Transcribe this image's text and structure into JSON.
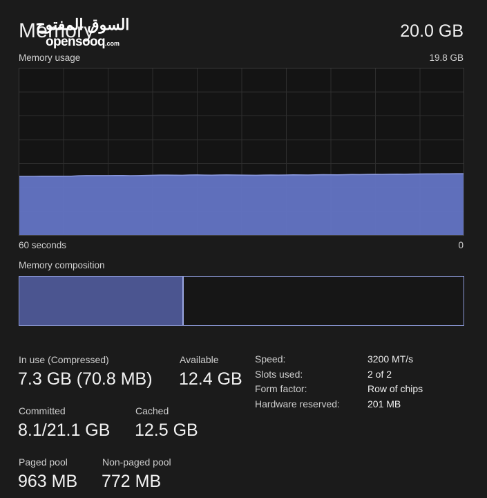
{
  "header": {
    "title": "Memory",
    "total": "20.0 GB",
    "watermark_arabic": "السوق المفتوح",
    "watermark_latin": "opensooq",
    "watermark_tld": ".com"
  },
  "usage_graph": {
    "caption": "Memory usage",
    "max_label": "19.8 GB",
    "axis_left": "60 seconds",
    "axis_right": "0"
  },
  "composition": {
    "caption": "Memory composition",
    "in_use_percent": 37,
    "free_percent": 63
  },
  "stats": {
    "in_use": {
      "label": "In use (Compressed)",
      "value": "7.3 GB (70.8 MB)"
    },
    "available": {
      "label": "Available",
      "value": "12.4 GB"
    },
    "committed": {
      "label": "Committed",
      "value": "8.1/21.1 GB"
    },
    "cached": {
      "label": "Cached",
      "value": "12.5 GB"
    },
    "paged_pool": {
      "label": "Paged pool",
      "value": "963 MB"
    },
    "non_paged_pool": {
      "label": "Non-paged pool",
      "value": "772 MB"
    }
  },
  "specs": [
    {
      "key": "Speed:",
      "value": "3200 MT/s"
    },
    {
      "key": "Slots used:",
      "value": "2 of 2"
    },
    {
      "key": "Form factor:",
      "value": "Row of chips"
    },
    {
      "key": "Hardware reserved:",
      "value": "201 MB"
    }
  ],
  "colors": {
    "background": "#1b1b1b",
    "graph_background": "#141414",
    "graph_fill": "#6374c4",
    "graph_line": "#8a98dd",
    "composition_fill": "#4b5590",
    "composition_border": "#8d9ad8",
    "grid": "#333333"
  },
  "chart_data": {
    "type": "area",
    "title": "Memory usage",
    "xlabel": "",
    "ylabel": "",
    "ylim": [
      0,
      19.8
    ],
    "xlim": [
      60,
      0
    ],
    "x_tick_labels": [
      "60 seconds",
      "0"
    ],
    "y_max_label": "19.8 GB",
    "grid": true,
    "legend": "none",
    "series": [
      {
        "name": "Memory in use (GB)",
        "values": [
          7.05,
          7.05,
          7.05,
          7.06,
          7.06,
          7.06,
          7.07,
          7.07,
          7.12,
          7.14,
          7.14,
          7.14,
          7.14,
          7.15,
          7.15,
          7.13,
          7.14,
          7.16,
          7.18,
          7.2,
          7.2,
          7.19,
          7.18,
          7.21,
          7.22,
          7.2,
          7.19,
          7.21,
          7.22,
          7.21,
          7.2,
          7.19,
          7.18,
          7.2,
          7.21,
          7.2,
          7.21,
          7.23,
          7.22,
          7.21,
          7.23,
          7.25,
          7.24,
          7.23,
          7.25,
          7.27,
          7.26,
          7.28,
          7.29,
          7.28,
          7.3,
          7.31,
          7.3,
          7.32,
          7.33,
          7.34,
          7.34,
          7.35,
          7.35,
          7.36,
          7.36
        ]
      }
    ]
  }
}
